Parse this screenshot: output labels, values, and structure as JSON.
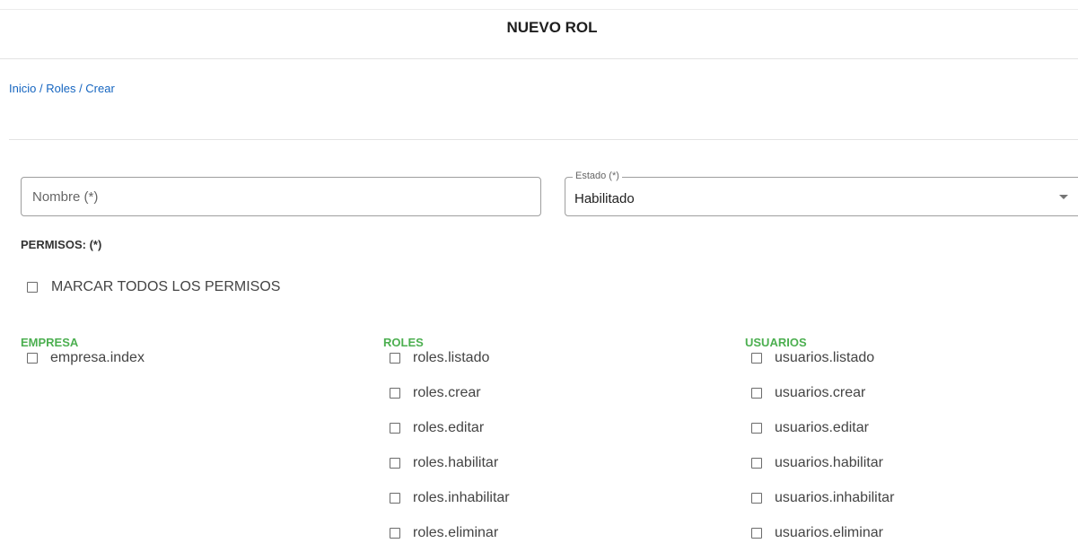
{
  "header": {
    "title": "NUEVO ROL"
  },
  "breadcrumb": {
    "inicio": "Inicio",
    "roles": "Roles",
    "crear": "Crear",
    "sep": " / "
  },
  "form": {
    "nombre_placeholder": "Nombre (*)",
    "estado_label": "Estado (*)",
    "estado_value": "Habilitado"
  },
  "permisos": {
    "label": "PERMISOS: (*)",
    "marcar_todos": "MARCAR TODOS LOS PERMISOS",
    "groups": [
      {
        "title": "EMPRESA",
        "items": [
          "empresa.index"
        ]
      },
      {
        "title": "ROLES",
        "items": [
          "roles.listado",
          "roles.crear",
          "roles.editar",
          "roles.habilitar",
          "roles.inhabilitar",
          "roles.eliminar"
        ]
      },
      {
        "title": "USUARIOS",
        "items": [
          "usuarios.listado",
          "usuarios.crear",
          "usuarios.editar",
          "usuarios.habilitar",
          "usuarios.inhabilitar",
          "usuarios.eliminar"
        ]
      }
    ]
  },
  "colors": {
    "accent_green": "#4caf50",
    "link_blue": "#1565c0"
  }
}
